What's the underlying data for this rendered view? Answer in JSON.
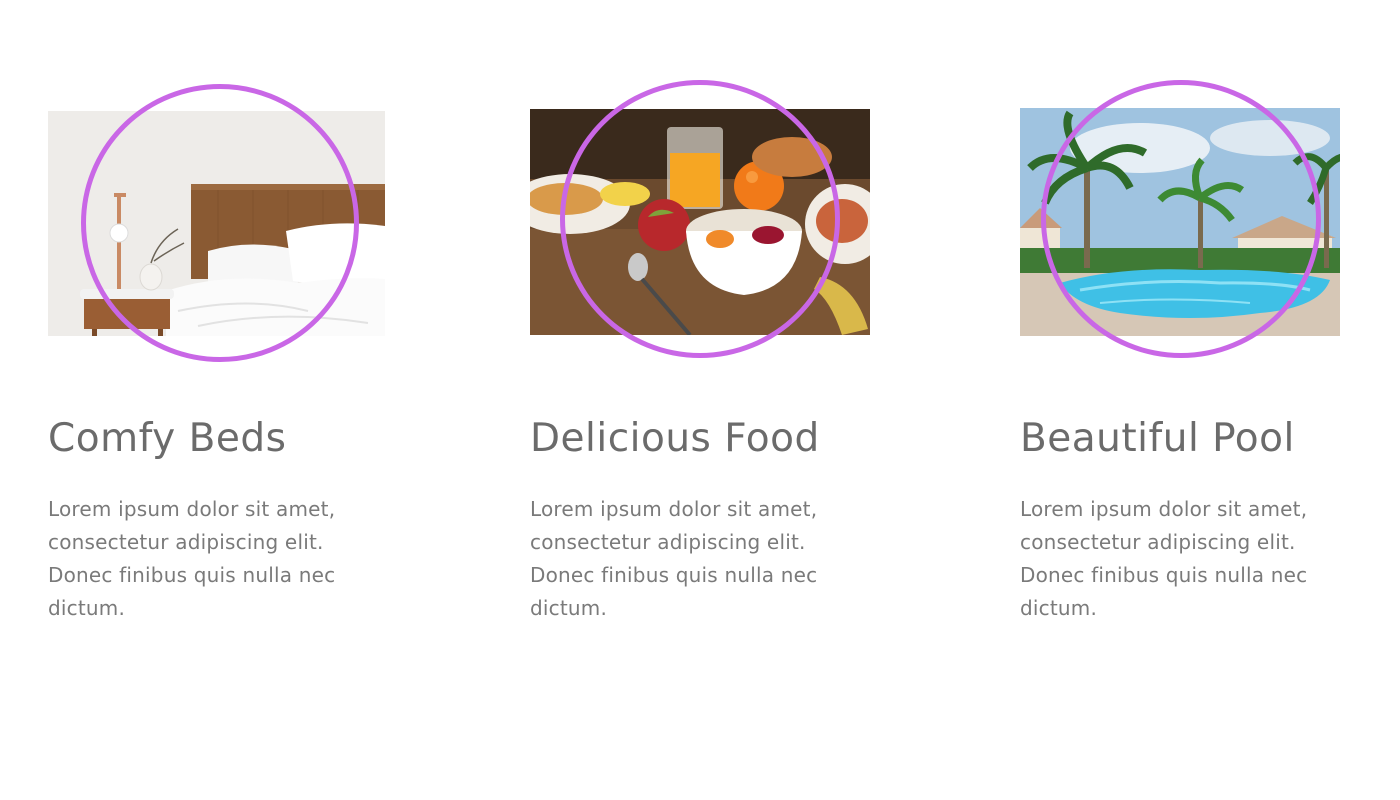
{
  "colors": {
    "ring": "#c967e6",
    "title": "#6b6b6b",
    "text": "#7a7a7a",
    "background": "#ffffff"
  },
  "features": [
    {
      "title": "Comfy Beds",
      "text": "Lorem ipsum dolor sit amet, consectetur adipiscing elit. Donec finibus quis nulla nec dictum.",
      "image": "bedroom-photo"
    },
    {
      "title": "Delicious Food",
      "text": "Lorem ipsum dolor sit amet, consectetur adipiscing elit. Donec finibus quis nulla nec dictum.",
      "image": "breakfast-photo"
    },
    {
      "title": "Beautiful Pool",
      "text": "Lorem ipsum dolor sit amet, consectetur adipiscing elit. Donec finibus quis nulla nec dictum.",
      "image": "pool-photo"
    }
  ]
}
